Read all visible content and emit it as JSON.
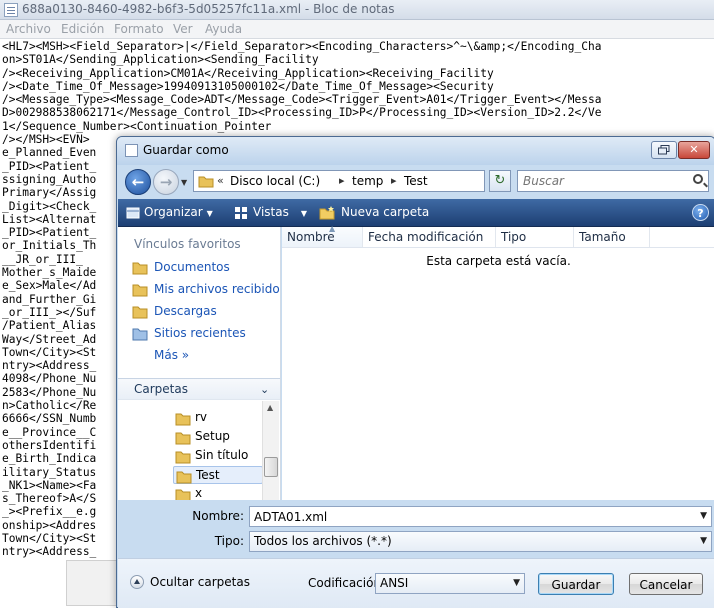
{
  "notepad": {
    "title": "688a0130-8460-4982-b6f3-5d05257fc11a.xml - Bloc de notas",
    "menu": [
      "Archivo",
      "Edición",
      "Formato",
      "Ver",
      "Ayuda"
    ],
    "lines": [
      "<HL7><MSH><Field_Separator>|</Field_Separator><Encoding_Characters>^~\\&amp;</Encoding_Cha",
      "on>ST01A</Sending_Application><Sending_Facility",
      "/><Receiving_Application>CM01A</Receiving_Application><Receiving_Facility",
      "/><Date_Time_Of_Message>19940913105000102</Date_Time_Of_Message><Security",
      "/><Message_Type><Message_Code>ADT</Message_Code><Trigger_Event>A01</Trigger_Event></Messa",
      "D>002988538062171</Message_Control_ID><Processing_ID>P</Processing_ID><Version_ID>2.2</Ve",
      "1</Sequence_Number><Continuation_Pointer",
      "/></MSH><EVN>",
      "e_Planned_Even",
      "_PID><Patient_",
      "ssigning_Autho",
      "Primary</Assig",
      "_Digit><Check_",
      "List><Alternat",
      "_PID><Patient_",
      "or_Initials_Th",
      "__JR_or_III_",
      "Mother_s_Maide",
      "e_Sex>Male</Ad",
      "and_Further_Gi",
      "_or_III_></Suf",
      "/Patient_Alias",
      "Way</Street_Ad",
      "Town</City><St",
      "ntry><Address_",
      "4098</Phone_Nu",
      "2583</Phone_Nu",
      "n>Catholic</Re",
      "6666</SSN_Numb",
      "e__Province__C",
      "othersIdentifi",
      "e_Birth_Indica",
      "ilitary_Status",
      "_NK1><Name><Fa",
      "s_Thereof>A</S",
      "_><Prefix__e.g",
      "onship><Addres",
      "Town</City><St",
      "ntry><Address_"
    ]
  },
  "dialog": {
    "title": "Guardar como",
    "address": {
      "crumbs": [
        "Disco local (C:)",
        "temp",
        "Test"
      ]
    },
    "search_placeholder": "Buscar",
    "toolbar": {
      "organize": "Organizar",
      "views": "Vistas",
      "new_folder": "Nueva carpeta"
    },
    "favorites_title": "Vínculos favoritos",
    "favorites": [
      "Documentos",
      "Mis archivos recibidos",
      "Descargas",
      "Sitios recientes"
    ],
    "more": "Más",
    "folders_title": "Carpetas",
    "tree": [
      "rv",
      "Setup",
      "Sin título",
      "Test",
      "x"
    ],
    "selected_tree_item": "Test",
    "columns": [
      "Nombre",
      "Fecha modificación",
      "Tipo",
      "Tamaño"
    ],
    "empty_message": "Esta carpeta está vacía.",
    "name_label": "Nombre:",
    "name_value": "ADTA01.xml",
    "type_label": "Tipo:",
    "type_value": "Todos los archivos  (*.*)",
    "hide_folders": "Ocultar carpetas",
    "encoding_label": "Codificación:",
    "encoding_value": "ANSI",
    "save": "Guardar",
    "cancel": "Cancelar"
  },
  "colors": {
    "toolbar": "#2a5590",
    "dialog_bg": "#c8dcf0",
    "link": "#1b55b6"
  }
}
